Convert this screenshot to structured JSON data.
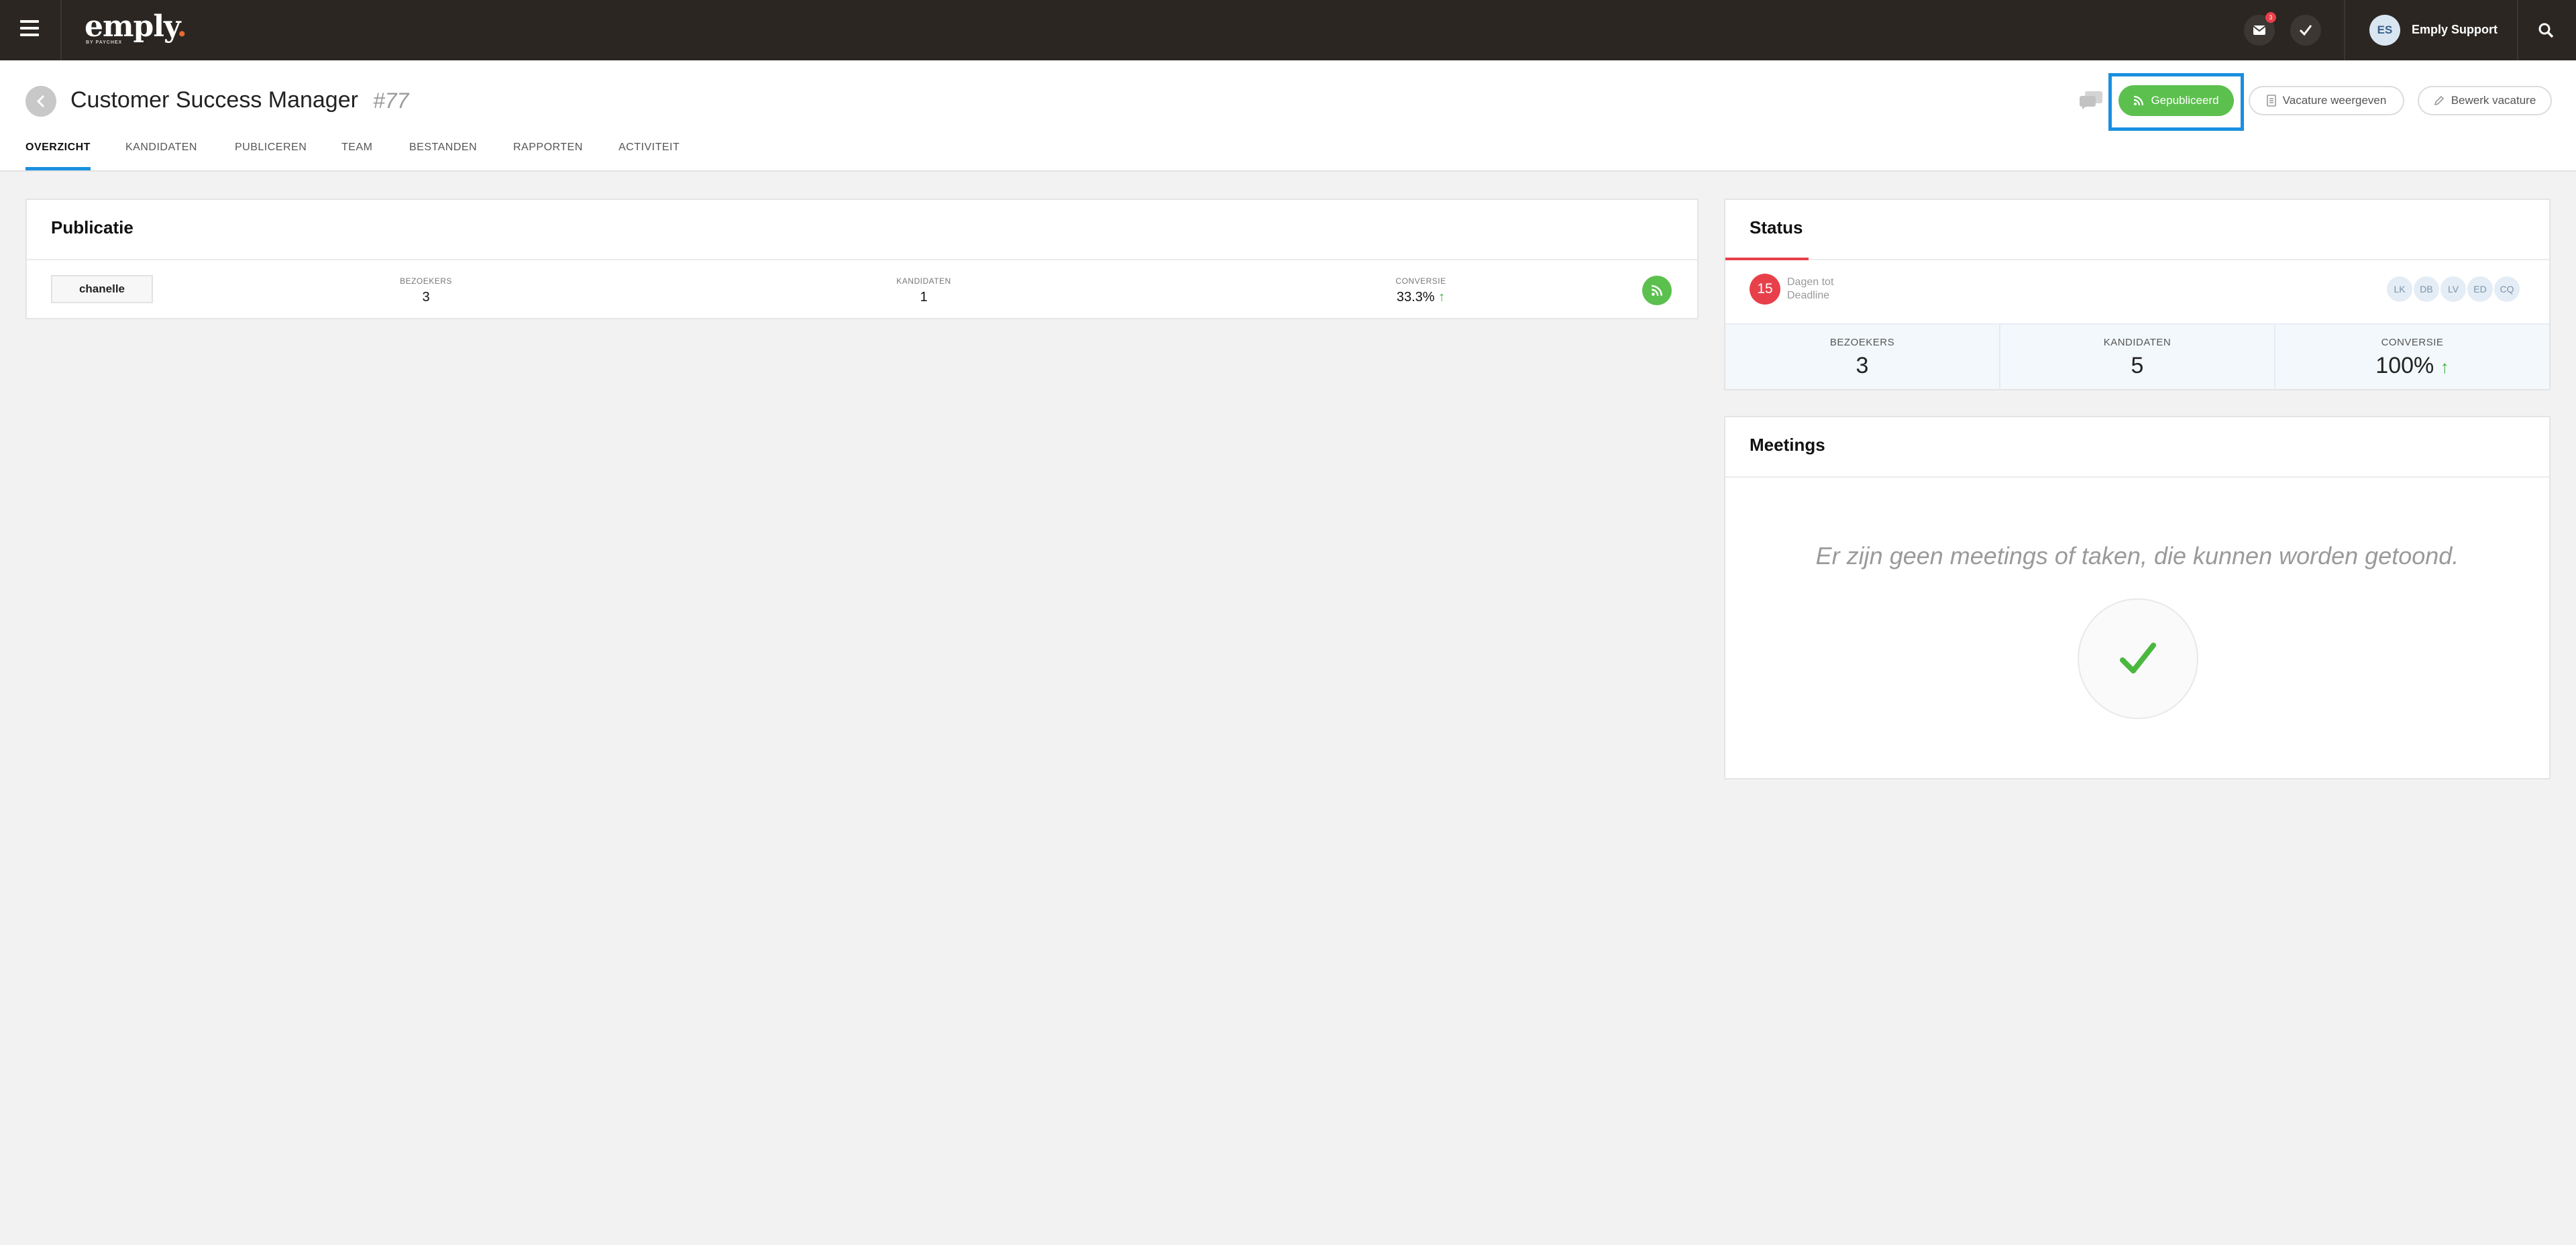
{
  "topbar": {
    "logo": "emply",
    "logo_dot": ".",
    "logo_sub": "BY PAYCHEX",
    "notification_count": "3",
    "user_initials": "ES",
    "user_name": "Emply Support",
    "icons": [
      "menu-icon",
      "mail-icon",
      "check-icon",
      "search-icon"
    ]
  },
  "header": {
    "title": "Customer Success Manager",
    "job_id": "#77",
    "published_label": "Gepubliceerd",
    "view_label": "Vacature weergeven",
    "edit_label": "Bewerk vacature",
    "tabs": [
      {
        "label": "OVERZICHT",
        "active": true
      },
      {
        "label": "KANDIDATEN",
        "active": false
      },
      {
        "label": "PUBLICEREN",
        "active": false
      },
      {
        "label": "TEAM",
        "active": false
      },
      {
        "label": "BESTANDEN",
        "active": false
      },
      {
        "label": "RAPPORTEN",
        "active": false
      },
      {
        "label": "ACTIVITEIT",
        "active": false
      }
    ]
  },
  "publication": {
    "title": "Publicatie",
    "channel": "chanelle",
    "visitors_label": "BEZOEKERS",
    "visitors": "3",
    "candidates_label": "KANDIDATEN",
    "candidates": "1",
    "conversion_label": "CONVERSIE",
    "conversion": "33.3%"
  },
  "status": {
    "title": "Status",
    "days": "15",
    "days_label_1": "Dagen tot",
    "days_label_2": "Deadline",
    "team": [
      "LK",
      "DB",
      "LV",
      "ED",
      "CQ"
    ],
    "visitors_label": "BEZOEKERS",
    "visitors": "3",
    "candidates_label": "KANDIDATEN",
    "candidates": "5",
    "conversion_label": "CONVERSIE",
    "conversion": "100%"
  },
  "meetings": {
    "title": "Meetings",
    "empty_text": "Er zijn geen meetings of taken, die kunnen worden getoond."
  },
  "colors": {
    "topbar": "#2b2622",
    "accent_blue": "#1a8fe0",
    "published_green": "#5cc04e",
    "deadline_red": "#e8404a",
    "logo_orange": "#e86a2c"
  }
}
